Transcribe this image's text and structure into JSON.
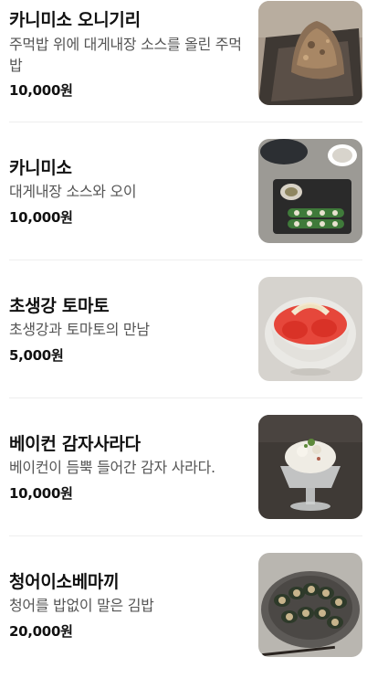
{
  "menu": {
    "items": [
      {
        "name": "카니미소 오니기리",
        "description": "주먹밥 위에 대게내장 소스를 올린 주먹밥",
        "price": "10,000원",
        "image": "kani-miso-onigiri-photo"
      },
      {
        "name": "카니미소",
        "description": "대게내장 소스와 오이",
        "price": "10,000원",
        "image": "kani-miso-photo"
      },
      {
        "name": "초생강 토마토",
        "description": "초생강과 토마토의 만남",
        "price": "5,000원",
        "image": "pickled-ginger-tomato-photo"
      },
      {
        "name": "베이컨 감자사라다",
        "description": "베이컨이 듬뿍 들어간 감자 사라다.",
        "price": "10,000원",
        "image": "bacon-potato-salad-photo"
      },
      {
        "name": "청어이소베마끼",
        "description": "청어를 밥없이 말은 김밥",
        "price": "20,000원",
        "image": "herring-isobe-maki-photo"
      }
    ]
  }
}
